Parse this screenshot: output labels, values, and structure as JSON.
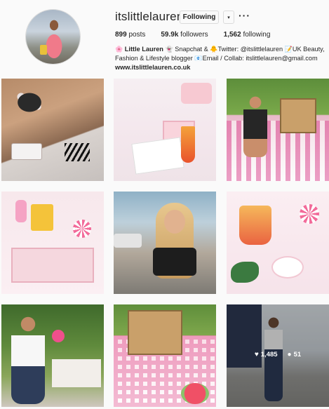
{
  "profile": {
    "username": "itslittlelauren",
    "follow_label": "Following",
    "dropdown_glyph": "▾",
    "more_glyph": "···",
    "stats": {
      "posts_count": "899",
      "posts_label": " posts",
      "followers_count": "59.9k",
      "followers_label": " followers",
      "following_count": "1,562",
      "following_label": " following"
    },
    "bio": {
      "emoji1": "🌸",
      "name": "Little Lauren",
      "emoji2": "👻",
      "snapchat": " Snapchat & ",
      "emoji3": "🐥",
      "twitter": "Twitter: @itslittlelauren ",
      "emoji4": "📝",
      "desc": "UK Beauty, Fashion & Lifestyle blogger ",
      "emoji5": "📧",
      "email": "Email / Collab: itslittlelauren@gmail.com ",
      "website": "www.itslittlelauren.co.uk"
    }
  },
  "posts": [
    {
      "alt": "lace-up-sandals-floral-dress"
    },
    {
      "alt": "ted-baker-desk"
    },
    {
      "alt": "picnic-floral-dress"
    },
    {
      "alt": "dessert-tray"
    },
    {
      "alt": "blonde-drink"
    },
    {
      "alt": "pink-party-drinks"
    },
    {
      "alt": "garden-girl-white-top"
    },
    {
      "alt": "picnic-basket-spread"
    },
    {
      "alt": "pizza-express-street",
      "likes": "1,485",
      "comments": "51"
    }
  ],
  "icons": {
    "heart": "heart-icon",
    "comment": "comment-icon"
  }
}
